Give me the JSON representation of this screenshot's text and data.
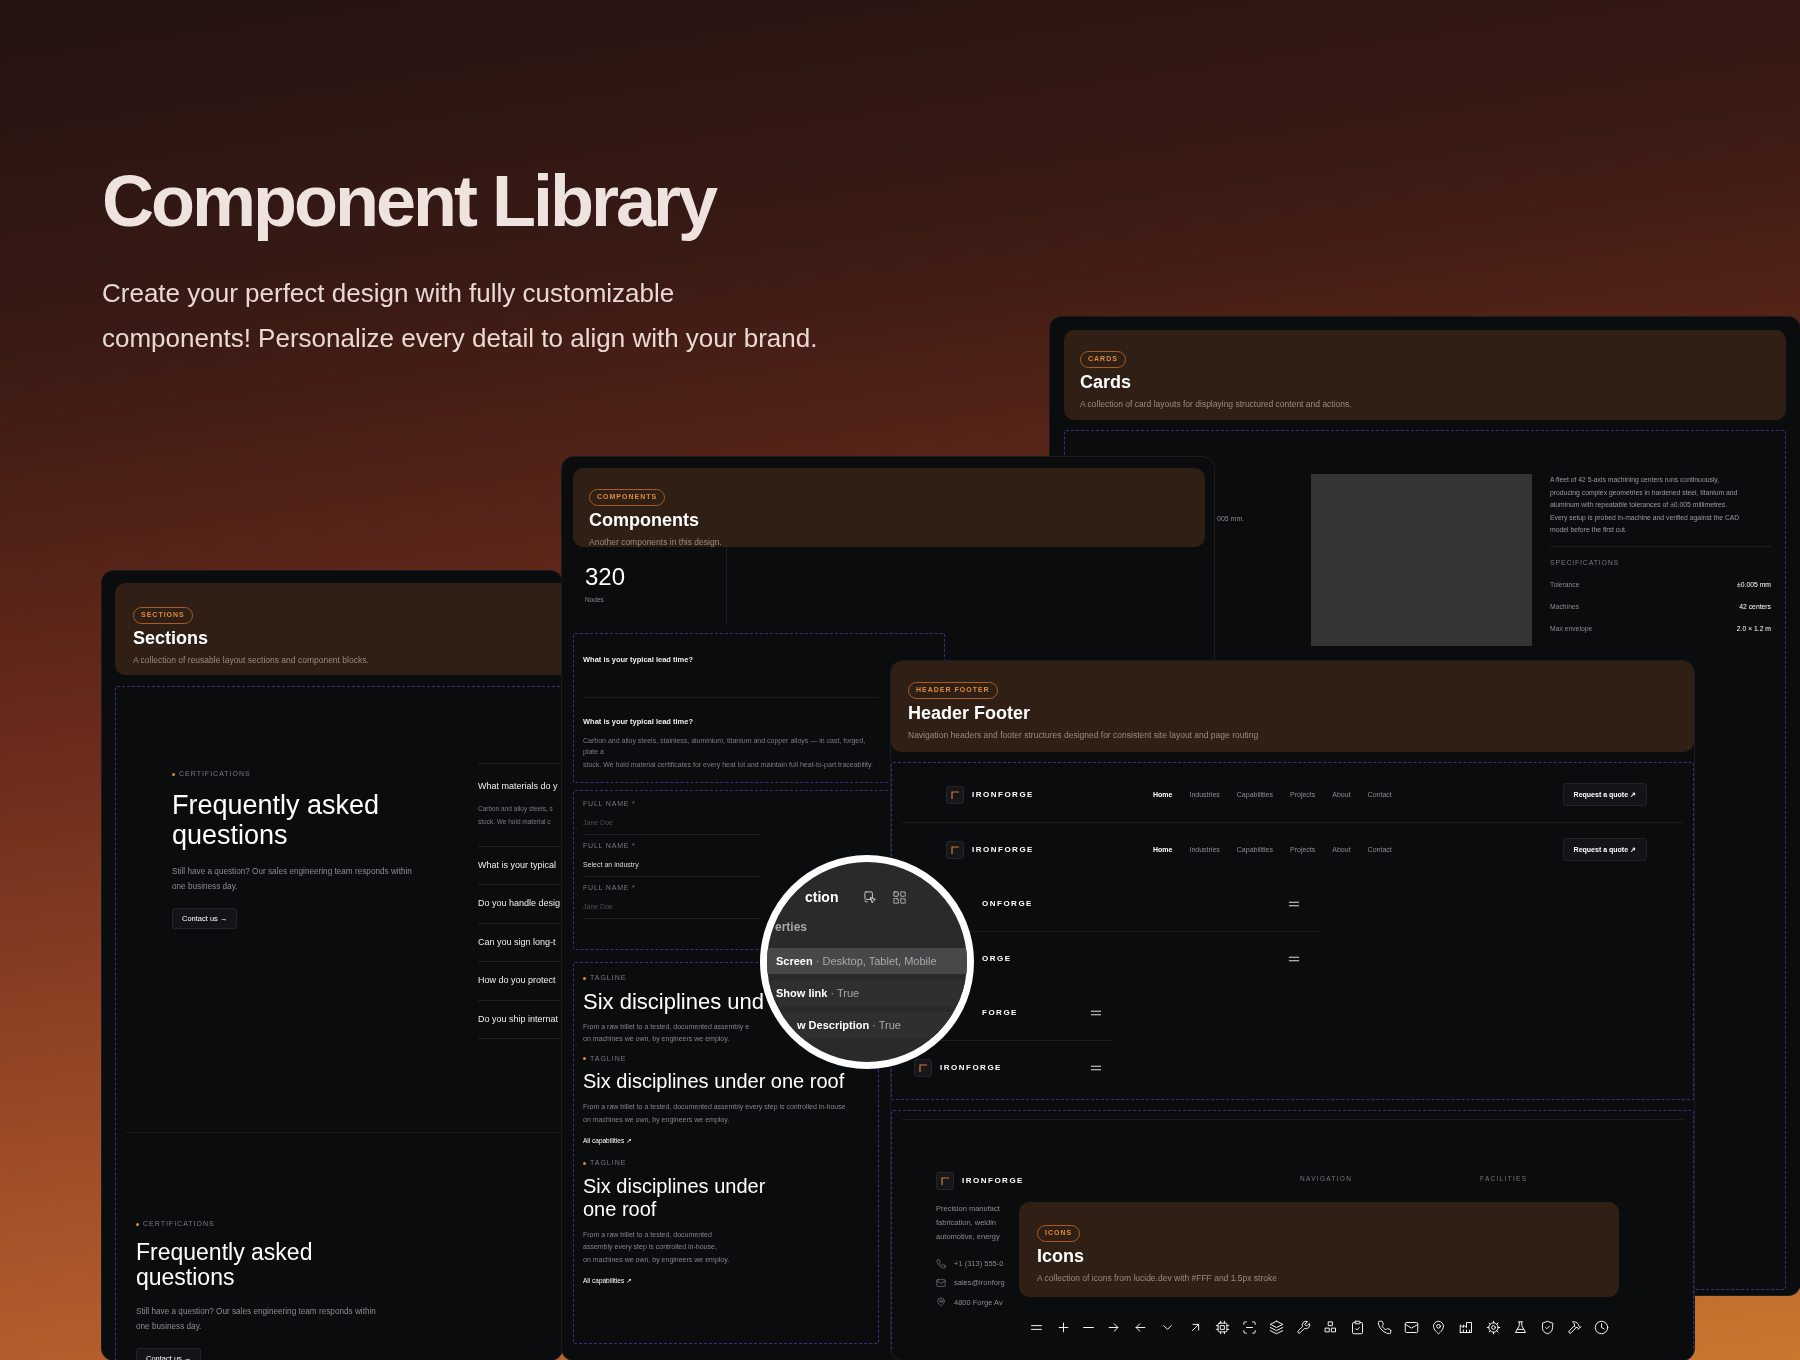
{
  "hero": {
    "title": "Component Library",
    "subtitle_lines": [
      "Create your perfect design with fully customizable",
      "components! Personalize every detail to align with your brand."
    ]
  },
  "cards_panel": {
    "badge": "CARDS",
    "title": "Cards",
    "description": "A collection of card layouts for displaying structured content and actions.",
    "fragment": "005 mm.",
    "body_lines": [
      "A fleet of 42 5-axis machining centers runs continuously,",
      "producing complex geometries in hardened steel, titanium and",
      "aluminum with repeatable tolerances of ±0.005 millimetres.",
      "Every setup is probed in-machine and verified against the CAD",
      "model before the first cut."
    ],
    "specs_heading": "SPECIFICATIONS",
    "specs": [
      {
        "label": "Tolerance",
        "value": "±0.005 mm"
      },
      {
        "label": "Machines",
        "value": "42 centers"
      },
      {
        "label": "Max envelope",
        "value": "2.0 × 1.2 m"
      }
    ]
  },
  "components_panel": {
    "badge": "COMPONENTS",
    "title": "Components",
    "description": "Another components in this design.",
    "stat": {
      "value": "320",
      "label": "Nodes"
    },
    "faq": [
      {
        "question": "What is your typical lead time?"
      },
      {
        "question": "What is your typical lead time?",
        "answer_lines": [
          "Carbon and alloy steels, stainless, aluminium, titanium and copper alloys — in cast, forged, plate a",
          "stock. We hold material certificates for every heat lot and maintain full heat-to-part traceability."
        ]
      }
    ],
    "form": [
      {
        "kind": "text",
        "label": "FULL NAME *",
        "placeholder": "Jane Doe"
      },
      {
        "kind": "select",
        "label": "FULL NAME *",
        "value": "Select an industry"
      },
      {
        "kind": "text",
        "label": "FULL NAME *",
        "placeholder": "Jane Doe"
      }
    ],
    "feature_blocks": [
      {
        "tagline": "TAGLINE",
        "heading_lines": [
          "Six disciplines und"
        ],
        "lines": [
          "From a raw billet to a tested, documented assembly e",
          "on machines we own, by engineers we employ."
        ]
      },
      {
        "tagline": "TAGLINE",
        "heading_lines": [
          "Six disciplines under one roof"
        ],
        "lines": [
          "From a raw billet to a tested, documented assembly every step is controlled in-house",
          "on machines we own, by engineers we employ."
        ],
        "link": "All capabilities ↗"
      },
      {
        "tagline": "TAGLINE",
        "heading_lines": [
          "Six disciplines under",
          "one roof"
        ],
        "lines": [
          "From a raw billet to a tested, documented",
          "assembly every step is controlled in-house,",
          "on machines we own, by engineers we employ."
        ],
        "link": "All capabilities ↗"
      }
    ]
  },
  "sections_panel": {
    "badge": "SECTIONS",
    "title": "Sections",
    "description": "A collection of reusable layout sections and component blocks.",
    "faq_blocks": [
      {
        "tagline": "CERTIFICATIONS",
        "heading": "Frequently asked questions",
        "lines": [
          "Still have a question? Our sales engineering team responds within",
          "one business day."
        ],
        "button": "Contact us →",
        "questions": [
          {
            "question": "What materials do y",
            "answer_lines": [
              "Carbon and alloy steels, s",
              "stock. We hold material c"
            ]
          },
          {
            "question": "What is your typical"
          },
          {
            "question": "Do you handle desig"
          },
          {
            "question": "Can you sign long-t"
          },
          {
            "question": "How do you protect"
          },
          {
            "question": "Do you ship internat"
          }
        ]
      },
      {
        "tagline": "CERTIFICATIONS",
        "heading": "Frequently asked questions",
        "lines": [
          "Still have a question? Our sales engineering team responds within",
          "one business day."
        ],
        "button": "Contact us →"
      }
    ]
  },
  "header_footer_panel": {
    "badge": "HEADER FOOTER",
    "title": "Header Footer",
    "description": "Navigation headers and footer structures designed for consistent site layout and page routing",
    "headers": [
      {
        "kind": "desktop",
        "show_logo": true,
        "brand": "IRONFORGE",
        "links": [
          {
            "label": "Home",
            "selected": true
          },
          {
            "label": "Industries",
            "selected": false
          },
          {
            "label": "Capabilities",
            "selected": false
          },
          {
            "label": "Projects",
            "selected": false
          },
          {
            "label": "About",
            "selected": false
          },
          {
            "label": "Contact",
            "selected": false
          }
        ],
        "button": "Request a quote ↗"
      },
      {
        "kind": "desktop",
        "show_logo": true,
        "brand": "IRONFORGE",
        "links": [
          {
            "label": "Home",
            "selected": true
          },
          {
            "label": "Industries",
            "selected": false
          },
          {
            "label": "Capabilities",
            "selected": false
          },
          {
            "label": "Projects",
            "selected": false
          },
          {
            "label": "About",
            "selected": false
          },
          {
            "label": "Contact",
            "selected": false
          }
        ],
        "button": "Request a quote ↗"
      },
      {
        "kind": "tablet",
        "show_logo": false,
        "brand": "ONFORGE"
      },
      {
        "kind": "tablet",
        "show_logo": false,
        "brand": "ORGE"
      },
      {
        "kind": "mobile",
        "show_logo": false,
        "brand": "FORGE"
      },
      {
        "kind": "mobile",
        "show_logo": true,
        "brand": "IRONFORGE"
      }
    ],
    "footer": {
      "brand": "IRONFORGE",
      "columns": [
        "NAVIGATION",
        "FACILITIES"
      ],
      "about_lines": [
        "Precision manufact",
        "fabrication, weldin",
        "automotive, energy"
      ],
      "contacts": [
        {
          "kind": "phone",
          "text": "+1 (313) 555-0"
        },
        {
          "kind": "mail",
          "text": "sales@ironforg"
        },
        {
          "kind": "pin",
          "text": "4800 Forge Av"
        }
      ]
    }
  },
  "icons_panel": {
    "badge": "ICONS",
    "title": "Icons",
    "description": "A collection of icons from lucide.dev with #FFF and 1.5px stroke"
  },
  "magnifier": {
    "heading": "ction",
    "section": "erties",
    "properties": [
      {
        "text": "**Screen** · Desktop, Tablet, Mobile",
        "selected": true
      },
      {
        "text": "**Show link** · True",
        "selected": false
      },
      {
        "text": "**w Description** · True",
        "selected": false
      }
    ]
  }
}
